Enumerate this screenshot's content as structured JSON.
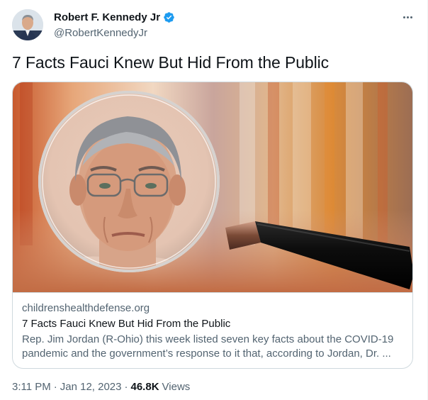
{
  "author": {
    "display_name": "Robert F. Kennedy Jr",
    "handle": "@RobertKennedyJr",
    "verified": true
  },
  "tweet": {
    "text": "7 Facts Fauci Knew But Hid From the Public",
    "time": "3:11 PM",
    "separator1": "·",
    "date": "Jan 12, 2023",
    "separator2": "·",
    "views_count": "46.8K",
    "views_label": "Views"
  },
  "card": {
    "domain": "childrenshealthdefense.org",
    "title": "7 Facts Fauci Knew But Hid From the Public",
    "description_line1": "Rep. Jim Jordan (R-Ohio) this week listed seven key facts about the COVID-19",
    "description_line2": "pandemic and the government’s response to it that, according to Jordan, Dr. ..."
  },
  "icons": {
    "verified": "verified-badge-icon",
    "more": "more-options-icon"
  },
  "colors": {
    "verified_blue": "#1d9bf0",
    "secondary_text": "#536471",
    "primary_text": "#0f1419",
    "border": "#cfd9de"
  }
}
